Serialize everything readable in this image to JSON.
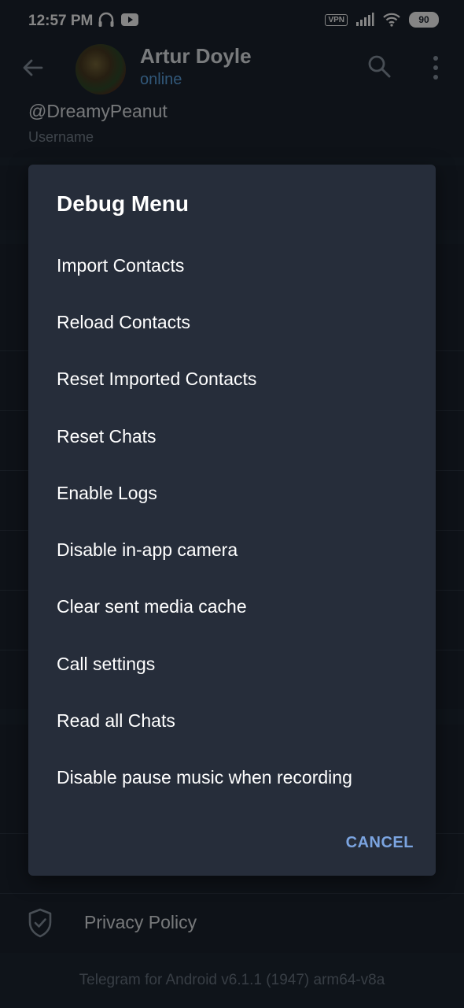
{
  "status_bar": {
    "time": "12:57 PM",
    "left_icons": [
      "headphones-icon",
      "youtube-icon"
    ],
    "vpn": "VPN",
    "battery": "90"
  },
  "header": {
    "contact_name": "Artur Doyle",
    "contact_status": "online"
  },
  "profile": {
    "username_value": "@DreamyPeanut",
    "username_label": "Username"
  },
  "background": {
    "privacy_label": "Privacy Policy",
    "footer": "Telegram for Android v6.1.1 (1947) arm64-v8a"
  },
  "dialog": {
    "title": "Debug Menu",
    "items": [
      "Import Contacts",
      "Reload Contacts",
      "Reset Imported Contacts",
      "Reset Chats",
      "Enable Logs",
      "Disable in-app camera",
      "Clear sent media cache",
      "Call settings",
      "Read all Chats",
      "Disable pause music when recording"
    ],
    "cancel_label": "CANCEL"
  },
  "colors": {
    "dialog_bg": "#262d3a",
    "accent": "#7ba4e0",
    "status_online": "#5ea8e8"
  }
}
